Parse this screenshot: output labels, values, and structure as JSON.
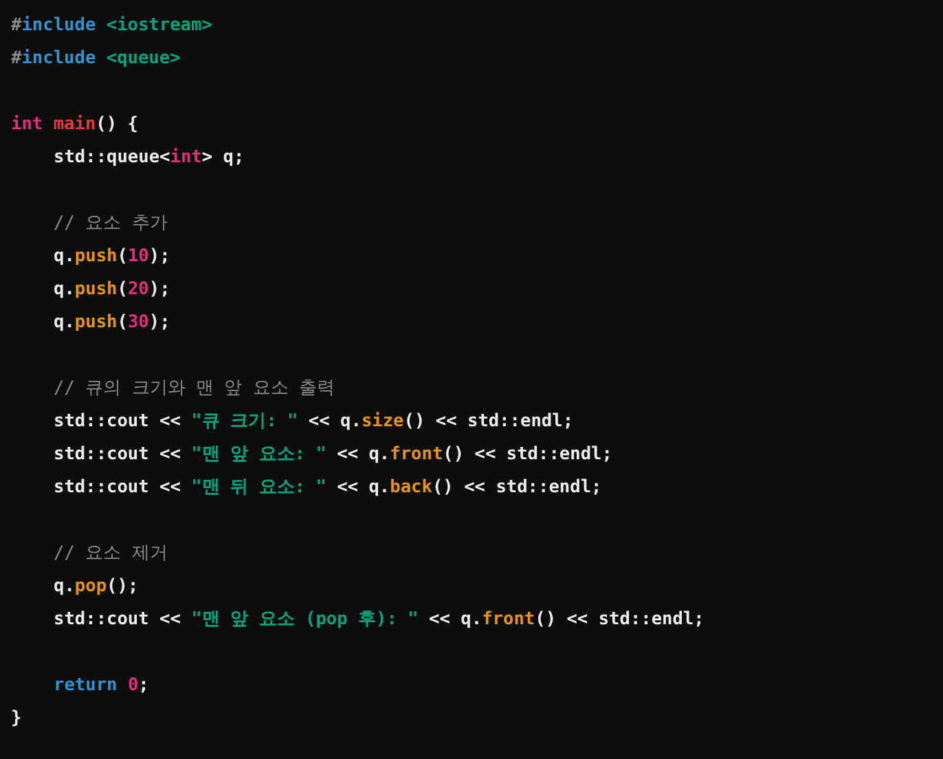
{
  "code_block": {
    "lines": [
      {
        "kind": "code",
        "indented": false,
        "tokens": [
          {
            "kind": "hash",
            "text": "#"
          },
          {
            "kind": "keyword",
            "text": "include"
          },
          {
            "kind": "string",
            "text": " <iostream>"
          }
        ]
      },
      {
        "kind": "code",
        "indented": false,
        "tokens": [
          {
            "kind": "hash",
            "text": "#"
          },
          {
            "kind": "keyword",
            "text": "include"
          },
          {
            "kind": "string",
            "text": " <queue>"
          }
        ]
      },
      {
        "kind": "blank"
      },
      {
        "kind": "code",
        "indented": false,
        "tokens": [
          {
            "kind": "type",
            "text": "int"
          },
          {
            "kind": "function",
            "text": " main"
          },
          {
            "kind": "plain",
            "text": "() {"
          }
        ]
      },
      {
        "kind": "code",
        "indented": true,
        "tokens": [
          {
            "kind": "plain",
            "text": "std::queue<"
          },
          {
            "kind": "type",
            "text": "int"
          },
          {
            "kind": "plain",
            "text": "> q;"
          }
        ]
      },
      {
        "kind": "blank"
      },
      {
        "kind": "code",
        "indented": true,
        "tokens": [
          {
            "kind": "comment",
            "text": "// 요소 추가"
          }
        ]
      },
      {
        "kind": "code",
        "indented": true,
        "tokens": [
          {
            "kind": "plain",
            "text": "q."
          },
          {
            "kind": "method",
            "text": "push"
          },
          {
            "kind": "plain",
            "text": "("
          },
          {
            "kind": "number",
            "text": "10"
          },
          {
            "kind": "plain",
            "text": ");"
          }
        ]
      },
      {
        "kind": "code",
        "indented": true,
        "tokens": [
          {
            "kind": "plain",
            "text": "q."
          },
          {
            "kind": "method",
            "text": "push"
          },
          {
            "kind": "plain",
            "text": "("
          },
          {
            "kind": "number",
            "text": "20"
          },
          {
            "kind": "plain",
            "text": ");"
          }
        ]
      },
      {
        "kind": "code",
        "indented": true,
        "tokens": [
          {
            "kind": "plain",
            "text": "q."
          },
          {
            "kind": "method",
            "text": "push"
          },
          {
            "kind": "plain",
            "text": "("
          },
          {
            "kind": "number",
            "text": "30"
          },
          {
            "kind": "plain",
            "text": ");"
          }
        ]
      },
      {
        "kind": "blank"
      },
      {
        "kind": "code",
        "indented": true,
        "tokens": [
          {
            "kind": "comment",
            "text": "// 큐의 크기와 맨 앞 요소 출력"
          }
        ]
      },
      {
        "kind": "code",
        "indented": true,
        "tokens": [
          {
            "kind": "plain",
            "text": "std::cout << "
          },
          {
            "kind": "string",
            "text": "\"큐 크기: \""
          },
          {
            "kind": "plain",
            "text": " << q."
          },
          {
            "kind": "method",
            "text": "size"
          },
          {
            "kind": "plain",
            "text": "() << std::endl;"
          }
        ]
      },
      {
        "kind": "code",
        "indented": true,
        "tokens": [
          {
            "kind": "plain",
            "text": "std::cout << "
          },
          {
            "kind": "string",
            "text": "\"맨 앞 요소: \""
          },
          {
            "kind": "plain",
            "text": " << q."
          },
          {
            "kind": "method",
            "text": "front"
          },
          {
            "kind": "plain",
            "text": "() << std::endl;"
          }
        ]
      },
      {
        "kind": "code",
        "indented": true,
        "tokens": [
          {
            "kind": "plain",
            "text": "std::cout << "
          },
          {
            "kind": "string",
            "text": "\"맨 뒤 요소: \""
          },
          {
            "kind": "plain",
            "text": " << q."
          },
          {
            "kind": "method",
            "text": "back"
          },
          {
            "kind": "plain",
            "text": "() << std::endl;"
          }
        ]
      },
      {
        "kind": "blank"
      },
      {
        "kind": "code",
        "indented": true,
        "tokens": [
          {
            "kind": "comment",
            "text": "// 요소 제거"
          }
        ]
      },
      {
        "kind": "code",
        "indented": true,
        "tokens": [
          {
            "kind": "plain",
            "text": "q."
          },
          {
            "kind": "method",
            "text": "pop"
          },
          {
            "kind": "plain",
            "text": "();"
          }
        ]
      },
      {
        "kind": "code",
        "indented": true,
        "tokens": [
          {
            "kind": "plain",
            "text": "std::cout << "
          },
          {
            "kind": "string",
            "text": "\"맨 앞 요소 (pop 후): \""
          },
          {
            "kind": "plain",
            "text": " << q."
          },
          {
            "kind": "method",
            "text": "front"
          },
          {
            "kind": "plain",
            "text": "() << std::endl;"
          }
        ]
      },
      {
        "kind": "blank"
      },
      {
        "kind": "code",
        "indented": true,
        "tokens": [
          {
            "kind": "keyword",
            "text": "return"
          },
          {
            "kind": "number",
            "text": " 0"
          },
          {
            "kind": "plain",
            "text": ";"
          }
        ]
      },
      {
        "kind": "code",
        "indented": false,
        "tokens": [
          {
            "kind": "plain",
            "text": "}"
          }
        ]
      }
    ]
  }
}
